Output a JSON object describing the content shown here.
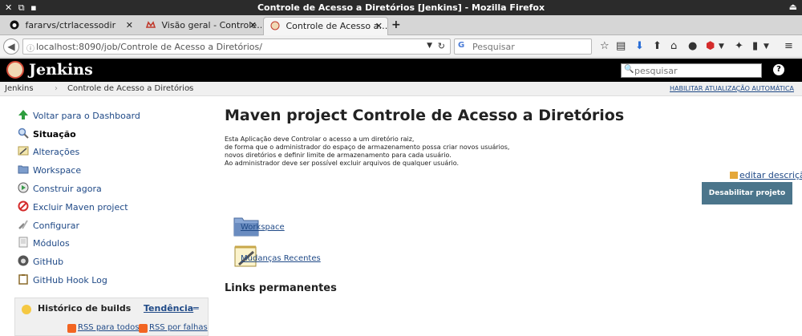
{
  "os": {
    "left_icons": "✕ ⧉ ▪",
    "window_title": "Controle de Acesso a Diretórios [Jenkins] - Mozilla Firefox",
    "right_icon": "⏏"
  },
  "browser": {
    "tabs": [
      {
        "label": "fararvs/ctrlacessodir",
        "icon": "github-icon",
        "close": "✕"
      },
      {
        "label": "Visão geral - Controle…",
        "icon": "gitlab-icon",
        "close": "✕"
      },
      {
        "label": "Controle de Acesso a…",
        "icon": "jenkins-icon",
        "close": "✕"
      }
    ],
    "new_tab": "+",
    "url": "localhost:8090/job/Controle de Acesso a Diretórios/",
    "search_placeholder": "Pesquisar",
    "toolbar_icons": [
      "star-icon",
      "clipboard-icon",
      "download-icon",
      "home-icon",
      "chat-icon",
      "adblock-icon",
      "extension-icon",
      "reader-icon",
      "menu-icon"
    ]
  },
  "jenkins": {
    "title": "Jenkins",
    "search_placeholder": "pesquisar",
    "help": "?",
    "breadcrumbs": [
      "Jenkins",
      "Controle de Acesso a Diretórios"
    ],
    "breadcrumb_sep": "›",
    "auto_refresh": "HABILITAR ATUALIZAÇÃO AUTOMÁTICA"
  },
  "sidebar": {
    "items": [
      {
        "label": "Voltar para o Dashboard",
        "icon": "arrow-up-icon",
        "color": "#2e9e3f"
      },
      {
        "label": "Situação",
        "icon": "search-icon",
        "color": "#5a7fb8",
        "bold": true
      },
      {
        "label": "Alterações",
        "icon": "notepad-icon",
        "color": "#c8b56a"
      },
      {
        "label": "Workspace",
        "icon": "folder-icon",
        "color": "#6a8cc0"
      },
      {
        "label": "Construir agora",
        "icon": "build-icon",
        "color": "#3a9a4a"
      },
      {
        "label": "Excluir Maven project",
        "icon": "delete-icon",
        "color": "#d42b2b"
      },
      {
        "label": "Configurar",
        "icon": "wrench-icon",
        "color": "#8a8a8a"
      },
      {
        "label": "Módulos",
        "icon": "document-icon",
        "color": "#bbbbbb"
      },
      {
        "label": "GitHub",
        "icon": "github-icon",
        "color": "#555555"
      },
      {
        "label": "GitHub Hook Log",
        "icon": "clipboard-icon",
        "color": "#b08a3a"
      }
    ],
    "history": {
      "label": "Histórico de builds",
      "trend": "Tendência",
      "trend_icon": "═",
      "rss_all": "RSS para todos",
      "rss_failures": "RSS por falhas"
    }
  },
  "main": {
    "title": "Maven project Controle de Acesso a Diretórios",
    "description": [
      "Esta Aplicação deve Controlar o acesso a um diretório raiz,",
      "de forma que o administrador do espaço de armazenamento possa criar novos usuários,",
      "novos diretórios e definir limite de armazenamento para cada usuário.",
      "Ao administrador deve ser possível excluir arquivos de qualquer usuário."
    ],
    "edit_description": "editar descrição",
    "disable_button": "Desabilitar projeto",
    "links": {
      "workspace": "Workspace",
      "changes": "Mudanças Recentes"
    },
    "permalinks_title": "Links permanentes"
  },
  "colors": {
    "link": "#204a87",
    "header_bg": "#000000",
    "button_bg": "#4b758b"
  }
}
